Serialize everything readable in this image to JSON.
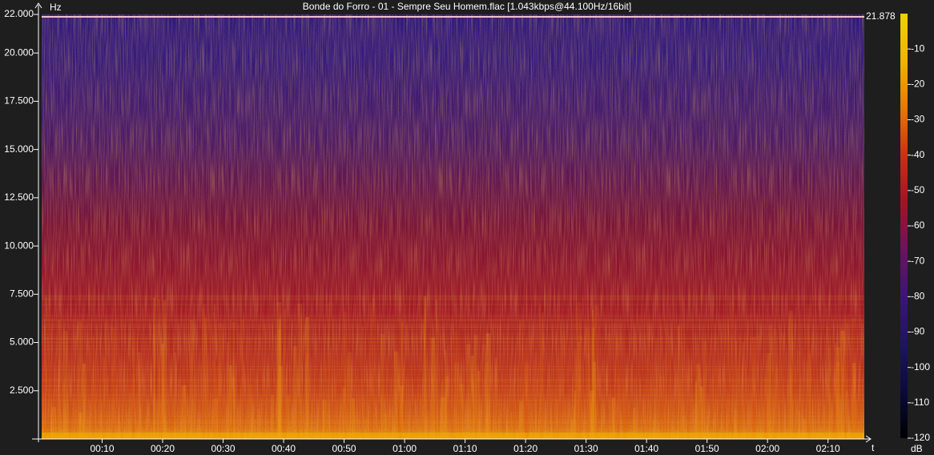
{
  "window": {
    "title": "Bonde do Forro - 01 - Sempre Seu Homem.flac [1.043kbps@44.100Hz/16bit]"
  },
  "chart_data": {
    "type": "heatmap",
    "title": "Bonde do Forro - 01 - Sempre Seu Homem.flac [1.043kbps@44.100Hz/16bit]",
    "file": "Bonde do Forro - 01 - Sempre Seu Homem.flac",
    "format": "1.043kbps@44.100Hz/16bit",
    "y_axis": {
      "label": "Hz",
      "range": [
        0,
        22000
      ],
      "ticks": [
        {
          "value": 2500,
          "label": "2.500"
        },
        {
          "value": 5000,
          "label": "5.000"
        },
        {
          "value": 7500,
          "label": "7.500"
        },
        {
          "value": 10000,
          "label": "10.000"
        },
        {
          "value": 12500,
          "label": "12.500"
        },
        {
          "value": 15000,
          "label": "15.000"
        },
        {
          "value": 17500,
          "label": "17.500"
        },
        {
          "value": 20000,
          "label": "20.000"
        },
        {
          "value": 22000,
          "label": "22.000"
        }
      ],
      "cutoff_marker": {
        "value": 21878,
        "label": "21.878"
      }
    },
    "x_axis": {
      "label": "t",
      "range_seconds": [
        0,
        136
      ],
      "ticks": [
        {
          "value": 10,
          "label": "00:10"
        },
        {
          "value": 20,
          "label": "00:20"
        },
        {
          "value": 30,
          "label": "00:30"
        },
        {
          "value": 40,
          "label": "00:40"
        },
        {
          "value": 50,
          "label": "00:50"
        },
        {
          "value": 60,
          "label": "01:00"
        },
        {
          "value": 70,
          "label": "01:10"
        },
        {
          "value": 80,
          "label": "01:20"
        },
        {
          "value": 90,
          "label": "01:30"
        },
        {
          "value": 100,
          "label": "01:40"
        },
        {
          "value": 110,
          "label": "01:50"
        },
        {
          "value": 120,
          "label": "02:00"
        },
        {
          "value": 130,
          "label": "02:10"
        }
      ]
    },
    "colorbar": {
      "label": "dB",
      "range": [
        -120,
        0
      ],
      "ticks": [
        {
          "value": -10,
          "label": "-10"
        },
        {
          "value": -20,
          "label": "-20"
        },
        {
          "value": -30,
          "label": "-30"
        },
        {
          "value": -40,
          "label": "-40"
        },
        {
          "value": -50,
          "label": "-50"
        },
        {
          "value": -60,
          "label": "-60"
        },
        {
          "value": -70,
          "label": "-70"
        },
        {
          "value": -80,
          "label": "-80"
        },
        {
          "value": -90,
          "label": "-90"
        },
        {
          "value": -100,
          "label": "-100"
        },
        {
          "value": -110,
          "label": "-110"
        },
        {
          "value": -120,
          "label": "-120"
        }
      ],
      "colors": [
        "#000000",
        "#0a0a3c",
        "#1e1464",
        "#3c1478",
        "#6e1260",
        "#a01423",
        "#c83214",
        "#e6780a",
        "#f0b400",
        "#f0d000"
      ]
    },
    "background_color": "#1e1e1e",
    "axis_color": "#ffffff"
  }
}
